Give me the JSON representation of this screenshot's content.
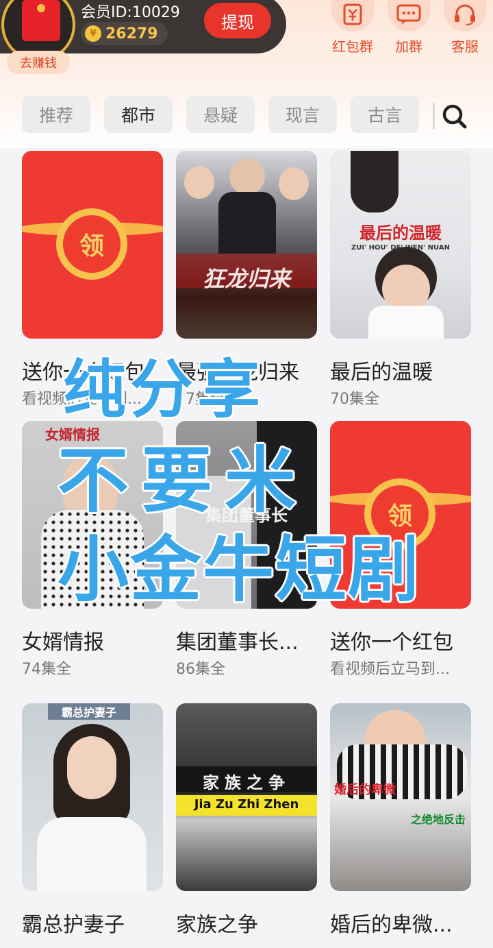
{
  "header": {
    "member_id": "会员ID:10029",
    "coins": "26279",
    "coin_symbol": "¥",
    "withdraw": "提现",
    "earn": "去赚钱",
    "actions": [
      {
        "label": "红包群",
        "icon": "red-envelope-icon"
      },
      {
        "label": "加群",
        "icon": "chat-bubble-icon"
      },
      {
        "label": "客服",
        "icon": "headset-icon"
      }
    ]
  },
  "tabs": [
    "推荐",
    "都市",
    "悬疑",
    "现言",
    "古言"
  ],
  "active_tab": "都市",
  "cards": [
    {
      "title": "送你一个红包",
      "sub": "看视频后立马到...",
      "type": "redpack",
      "seal": "领"
    },
    {
      "title": "最强狂龙归来",
      "sub": "77集全",
      "type": "poster",
      "poster_text": "狂龙归来"
    },
    {
      "title": "最后的温暖",
      "sub": "70集全",
      "type": "poster",
      "poster_text": "最后的温暖",
      "poster_sub": "ZUI' HOU' DE' WEN' NUAN"
    },
    {
      "title": "女婿情报",
      "sub": "74集全",
      "type": "poster",
      "poster_text": "女婿情报"
    },
    {
      "title": "集团董事长...",
      "sub": "86集全",
      "type": "poster",
      "poster_text": "集团董事长"
    },
    {
      "title": "送你一个红包",
      "sub": "看视频后立马到...",
      "type": "redpack",
      "seal": "领"
    },
    {
      "title": "霸总护妻子",
      "sub": "",
      "type": "poster",
      "poster_text": "霸总护妻子"
    },
    {
      "title": "家族之争",
      "sub": "",
      "type": "poster",
      "poster_text": "家族之争",
      "poster_sub": "Jia Zu Zhi Zhen"
    },
    {
      "title": "婚后的卑微...",
      "sub": "",
      "type": "poster",
      "poster_text": "婚后的卑微",
      "poster_sub": "之绝地反击"
    }
  ],
  "watermark": [
    "纯分享",
    "不要米",
    "小金牛短剧"
  ],
  "colors": {
    "accent": "#e9342c",
    "brand_orange": "#e24d2a",
    "watermark": "#3aa6ea"
  }
}
